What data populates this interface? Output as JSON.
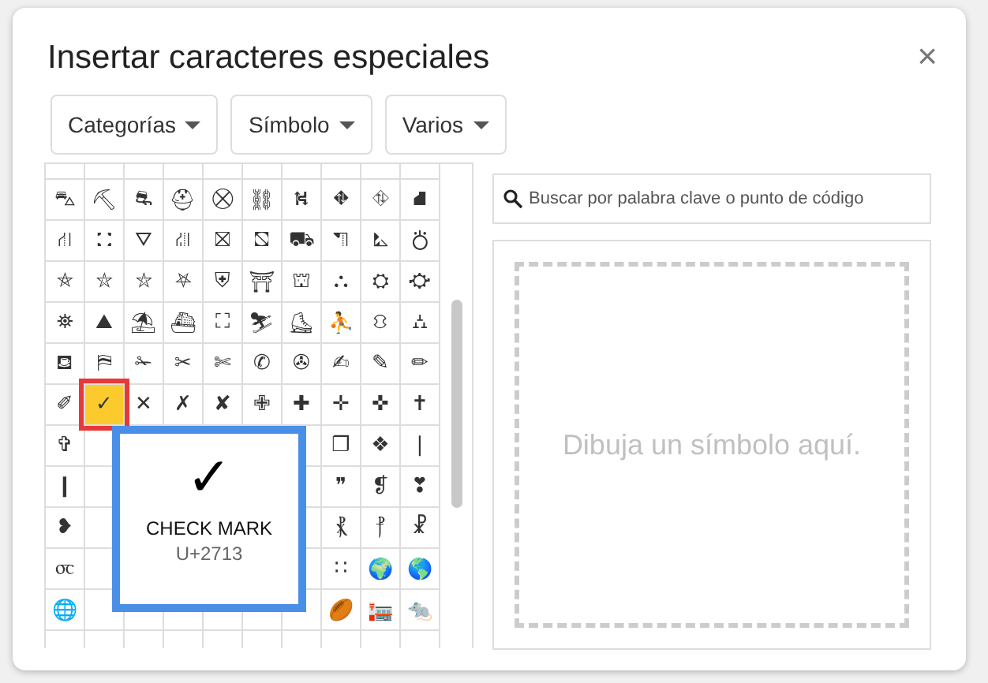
{
  "dialog": {
    "title": "Insertar caracteres especiales",
    "close": "×"
  },
  "dropdowns": [
    {
      "label": "Categorías"
    },
    {
      "label": "Símbolo"
    },
    {
      "label": "Varios"
    }
  ],
  "grid": {
    "rows": [
      [
        null,
        null,
        null,
        null,
        null,
        null,
        null,
        null,
        null,
        null
      ],
      [
        {
          "char": "⛍",
          "selected": false
        },
        {
          "char": "⛏",
          "selected": false
        },
        {
          "char": "⛐",
          "selected": false
        },
        {
          "char": "⛑",
          "selected": false
        },
        {
          "char": "⛒",
          "selected": false
        },
        {
          "char": "⛓",
          "selected": false
        },
        {
          "char": "⛕",
          "selected": false
        },
        {
          "char": "⛖",
          "selected": false
        },
        {
          "char": "⛗",
          "selected": false
        },
        {
          "char": "⛘",
          "selected": false
        }
      ],
      [
        {
          "char": "⛙",
          "selected": false
        },
        {
          "char": "⛚",
          "selected": false
        },
        {
          "char": "⛛",
          "selected": false
        },
        {
          "char": "⛜",
          "selected": false
        },
        {
          "char": "⛝",
          "selected": false
        },
        {
          "char": "⛞",
          "selected": false
        },
        {
          "char": "⛟",
          "selected": false
        },
        {
          "char": "⛠",
          "selected": false
        },
        {
          "char": "⛡",
          "selected": false
        },
        {
          "char": "⛣",
          "selected": false
        }
      ],
      [
        {
          "char": "⛤",
          "selected": false
        },
        {
          "char": "⛥",
          "selected": false
        },
        {
          "char": "⛦",
          "selected": false
        },
        {
          "char": "⛧",
          "selected": false
        },
        {
          "char": "⛨",
          "selected": false
        },
        {
          "char": "⛩",
          "selected": false
        },
        {
          "char": "⛫",
          "selected": false
        },
        {
          "char": "⛬",
          "selected": false
        },
        {
          "char": "⛭",
          "selected": false
        },
        {
          "char": "⛮",
          "selected": false
        }
      ],
      [
        {
          "char": "⛯",
          "selected": false
        },
        {
          "char": "⛰",
          "selected": false
        },
        {
          "char": "⛱",
          "selected": false
        },
        {
          "char": "⛴",
          "selected": false
        },
        {
          "char": "⛶",
          "selected": false
        },
        {
          "char": "⛷",
          "selected": false
        },
        {
          "char": "⛸",
          "selected": false
        },
        {
          "char": "⛹",
          "selected": false
        },
        {
          "char": "⛻",
          "selected": false
        },
        {
          "char": "⛼",
          "selected": false
        }
      ],
      [
        {
          "char": "⛾",
          "selected": false
        },
        {
          "char": "⛿",
          "selected": false
        },
        {
          "char": "✁",
          "selected": false
        },
        {
          "char": "✂",
          "selected": false
        },
        {
          "char": "✄",
          "selected": false
        },
        {
          "char": "✆",
          "selected": false
        },
        {
          "char": "✇",
          "selected": false
        },
        {
          "char": "✍",
          "selected": false
        },
        {
          "char": "✎",
          "selected": false
        },
        {
          "char": "✏",
          "selected": false
        }
      ],
      [
        {
          "char": "✐",
          "selected": false
        },
        {
          "char": "✓",
          "selected": true
        },
        {
          "char": "✕",
          "selected": false
        },
        {
          "char": "✗",
          "selected": false
        },
        {
          "char": "✘",
          "selected": false
        },
        {
          "char": "✙",
          "selected": false
        },
        {
          "char": "✚",
          "selected": false
        },
        {
          "char": "✛",
          "selected": false
        },
        {
          "char": "✜",
          "selected": false
        },
        {
          "char": "✝",
          "selected": false
        }
      ],
      [
        {
          "char": "✞",
          "selected": false
        },
        null,
        null,
        null,
        null,
        null,
        null,
        {
          "char": "❐",
          "selected": false
        },
        {
          "char": "❖",
          "selected": false
        },
        {
          "char": "❘",
          "selected": false
        }
      ],
      [
        {
          "char": "❙",
          "selected": false
        },
        null,
        null,
        null,
        null,
        null,
        null,
        {
          "char": "❞",
          "selected": false
        },
        {
          "char": "❡",
          "selected": false
        },
        {
          "char": "❣",
          "selected": false
        }
      ],
      [
        {
          "char": "❥",
          "selected": false
        },
        null,
        null,
        null,
        null,
        null,
        null,
        {
          "char": "⳩",
          "selected": false
        },
        {
          "char": "⳨",
          "selected": false
        },
        {
          "char": "☧",
          "selected": false
        }
      ],
      [
        {
          "char": "⳪",
          "selected": false
        },
        null,
        null,
        null,
        null,
        null,
        null,
        {
          "char": "∷",
          "selected": false
        },
        {
          "char": "🌍",
          "selected": false
        },
        {
          "char": "🌎",
          "selected": false
        }
      ],
      [
        {
          "char": "🌐",
          "selected": false
        },
        null,
        null,
        null,
        null,
        null,
        null,
        {
          "char": "🏉",
          "selected": false
        },
        {
          "char": "🏣",
          "selected": false
        },
        {
          "char": "🐀",
          "selected": false
        }
      ],
      [
        null,
        null,
        null,
        null,
        null,
        null,
        null,
        null,
        null,
        null
      ]
    ]
  },
  "tooltip": {
    "glyph": "✓",
    "name": "CHECK MARK",
    "code": "U+2713"
  },
  "search": {
    "placeholder": "Buscar por palabra clave o punto de código"
  },
  "draw_area": {
    "hint": "Dibuja un símbolo aquí."
  }
}
